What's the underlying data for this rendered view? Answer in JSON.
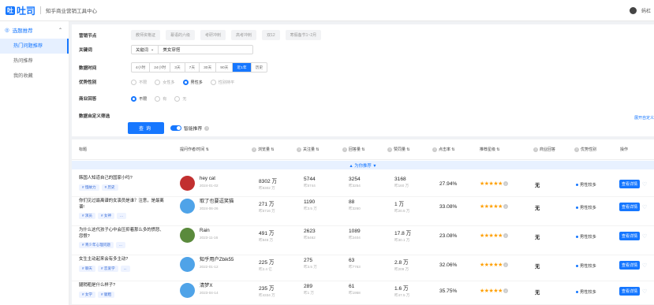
{
  "app": {
    "logo_text": "吐司",
    "logo_icon": "吐",
    "title": "知乎商业营销工具中心",
    "user_name": "蚂杠"
  },
  "sidebar": {
    "group_label": "选题推荐",
    "items": [
      {
        "label": "热门问题推荐",
        "active": true
      },
      {
        "label": "热问推荐",
        "active": false
      },
      {
        "label": "我的收藏",
        "active": false
      }
    ]
  },
  "filters": {
    "marketing_label": "营销节点",
    "marketing_tags": [
      "教师资格证",
      "幕语的六级",
      "考研冲刺",
      "高考冲刺",
      "双12",
      "寒假备节1~2月"
    ],
    "keyword_label": "关键词",
    "keyword_type": "关键词",
    "keyword_value": "美女穿搭",
    "time_label": "数据时间",
    "time_options": [
      "4小时",
      "24小时",
      "3天",
      "7天",
      "30天",
      "90天",
      "近1年",
      "历史"
    ],
    "time_active": 6,
    "gender_label": "优势性别",
    "gender_options": [
      "不限",
      "女性多",
      "男性多",
      "性别持平"
    ],
    "gender_active": 2,
    "commercial_label": "商业回答",
    "commercial_options": [
      "不限",
      "有",
      "无"
    ],
    "commercial_active": 0,
    "custom_label": "数据自定义筛选",
    "query_button": "查询",
    "smart_label": "智能推荐",
    "expand_link": "展开自定义"
  },
  "table": {
    "headers": [
      "标题",
      "提问作者/时间 ⇅",
      "浏览量 ⇅",
      "关注量 ⇅",
      "回答量 ⇅",
      "赞同量 ⇅",
      "点击率 ⇅",
      "推荐星级 ⇅",
      "商业回答",
      "优势性别",
      "操作"
    ],
    "hint": "▲ 为你推荐 ▼",
    "rows": [
      {
        "title": "韩国人知道自己的国家小吗?",
        "tags": [
          "# 慢故力",
          "# 历史"
        ],
        "author": "hey cat",
        "date": "2024-01-02",
        "avatar_color": "#c23030",
        "views": "8302 万",
        "views_sub": "昨8302 万",
        "follows": "5744",
        "follows_sub": "昨5744",
        "answers": "3254",
        "answers_sub": "昨3254",
        "likes": "3168",
        "likes_sub": "昨160 万",
        "ctr": "27.94%",
        "stars": "★★★★★",
        "commercial": "无",
        "gender": "男性较多",
        "action": "查看详情"
      },
      {
        "title": "你们见过最离谱的女演员是谁？注意，是最离谱!",
        "tags": [
          "# 演员",
          "# 女神",
          "..."
        ],
        "author": "取了也要逗笑猫",
        "date": "2024-06-26",
        "avatar_color": "#4fa3e8",
        "views": "271 万",
        "views_sub": "昨5716 万",
        "follows": "1190",
        "follows_sub": "昨3.5 万",
        "answers": "88",
        "answers_sub": "昨3260",
        "likes": "1 万",
        "likes_sub": "昨20.5 万",
        "ctr": "33.08%",
        "stars": "★★★★★",
        "commercial": "无",
        "gender": "男性较多",
        "action": "查看详情"
      },
      {
        "title": "为什么这代孩子心中会压抑着那么多的愤怒、怨恨?",
        "tags": [
          "# 青少年心理问题",
          "..."
        ],
        "author": "Rain",
        "date": "2023-11-16",
        "avatar_color": "#5a8a3c",
        "views": "491 万",
        "views_sub": "昨846 万",
        "follows": "2623",
        "follows_sub": "昨6462",
        "answers": "1089",
        "answers_sub": "昨2404",
        "likes": "17.8 万",
        "likes_sub": "昨30.1 万",
        "ctr": "23.08%",
        "stars": "★★★★★",
        "commercial": "无",
        "gender": "男性较多",
        "action": "查看详情"
      },
      {
        "title": "女生主动起来会有多主动?",
        "tags": [
          "# 聊天",
          "# 恋爱学",
          "..."
        ],
        "author": "知乎用户Zbik55",
        "date": "2022-01-12",
        "avatar_color": "#4fa3e8",
        "views": "225 万",
        "views_sub": "昨2.4 亿",
        "follows": "275",
        "follows_sub": "昨3.5 万",
        "answers": "63",
        "answers_sub": "昨7763",
        "likes": "2.8 万",
        "likes_sub": "昨209 万",
        "ctr": "32.06%",
        "stars": "★★★★★",
        "commercial": "无",
        "gender": "男性较多",
        "action": "查看详情"
      },
      {
        "title": "腿稍粗是什么样子?",
        "tags": [
          "# 女学",
          "# 腿粗"
        ],
        "author": "清梦X",
        "date": "2023-04-14",
        "avatar_color": "#4fa3e8",
        "views": "235 万",
        "views_sub": "昨4334 万",
        "follows": "289",
        "follows_sub": "昨1 万",
        "answers": "61",
        "answers_sub": "昨1958",
        "likes": "1.6 万",
        "likes_sub": "昨47.5 万",
        "ctr": "35.75%",
        "stars": "★★★★★",
        "commercial": "无",
        "gender": "男性较多",
        "action": "查看详情"
      }
    ]
  }
}
